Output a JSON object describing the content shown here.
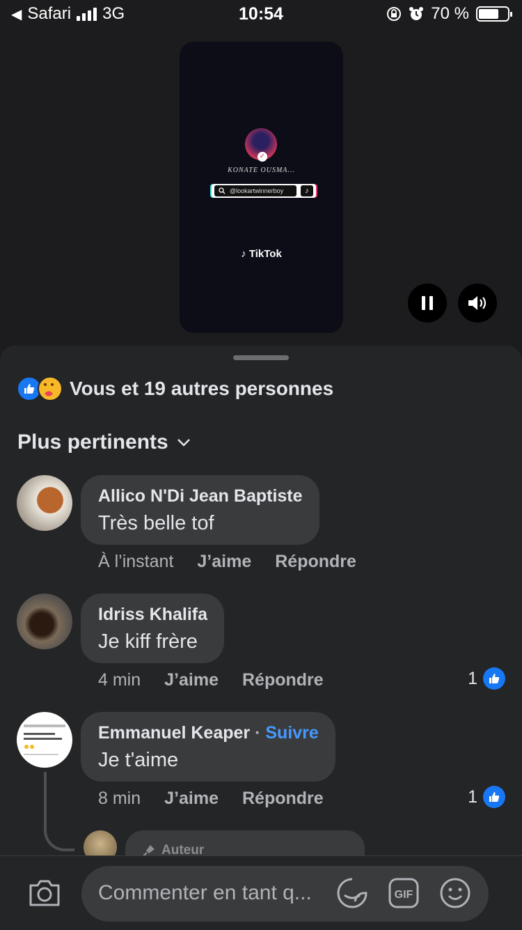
{
  "status_bar": {
    "back_app": "Safari",
    "network": "3G",
    "time": "10:54",
    "battery_percent": "70 %",
    "battery_level": 0.7
  },
  "video": {
    "creator_name": "KONATE OUSMA...",
    "handle": "@lookartwinnerboy",
    "brand": "TikTok",
    "controls": {
      "pause_icon": "pause-icon",
      "volume_icon": "volume-icon"
    }
  },
  "reactions": {
    "summary": "Vous et 19 autres personnes",
    "icons": [
      "like-reaction-icon",
      "care-reaction-icon"
    ]
  },
  "sort": {
    "label": "Plus pertinents"
  },
  "comments": [
    {
      "author": "Allico N'Di Jean Baptiste",
      "follow": "",
      "text": "Très belle tof",
      "time": "À l’instant",
      "like_label": "J’aime",
      "reply_label": "Répondre",
      "likes": ""
    },
    {
      "author": "Idriss Khalifa",
      "follow": "",
      "text": "Je kiff frère",
      "time": "4 min",
      "like_label": "J’aime",
      "reply_label": "Répondre",
      "likes": "1"
    },
    {
      "author": "Emmanuel Keaper",
      "follow": "Suivre",
      "text": "Je t'aime",
      "time": "8 min",
      "like_label": "J’aime",
      "reply_label": "Répondre",
      "likes": "1"
    }
  ],
  "reply_preview": {
    "badge": "Auteur"
  },
  "composer": {
    "placeholder": "Commenter en tant q...",
    "gif_label": "GIF",
    "icons": [
      "camera-icon",
      "sticker-icon",
      "gif-icon",
      "emoji-icon"
    ]
  },
  "colors": {
    "sheet_bg": "#242526",
    "bubble_bg": "#3a3b3c",
    "accent_blue": "#1877f2",
    "link_blue": "#4599ff",
    "secondary_text": "#b0b3b8"
  }
}
